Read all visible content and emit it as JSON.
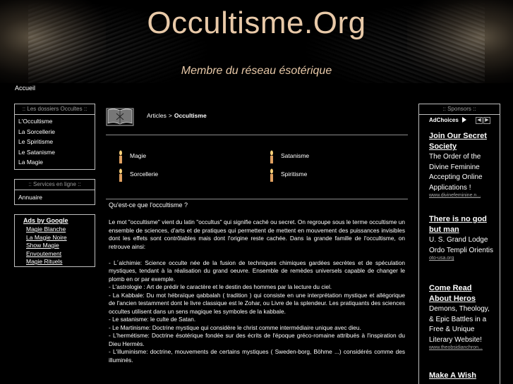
{
  "header": {
    "title": "Occultisme.Org",
    "subtitle": "Membre du réseau ésotérique",
    "home_link": "Accueil"
  },
  "left": {
    "dossiers": {
      "title": ":: Les dossiers Occultes ::",
      "items": [
        "L'Occultisme",
        "La Sorcellerie",
        "Le Spiritisme",
        "Le Satanisme",
        "La Magie"
      ]
    },
    "services": {
      "title": ":: Services en ligne ::",
      "items": [
        "Annuaire"
      ]
    },
    "ads": {
      "heading": "Ads by Google",
      "links": [
        "Magie Blanche",
        "La Magie Noire",
        "Show Magie",
        "Envoutement",
        "Magie Rituels"
      ]
    }
  },
  "center": {
    "breadcrumb": {
      "parent": "Articles",
      "separator": ">",
      "current": "Occultisme"
    },
    "categories": [
      "Magie",
      "Satanisme",
      "Sorcellerie",
      "Spiritisme"
    ],
    "intro_title": "Qu'est-ce que l'occultisme ?",
    "paragraphs": [
      "Le mot \"occultisme\" vient du latin \"occultus\" qui signifie caché ou secret. On regroupe sous le terme occultisme un ensemble de sciences, d'arts et de pratiques qui permettent de mettent en mouvement des puissances invisibles dont les effets sont contrôlables mais dont l'origine reste cachée. Dans la grande famille de l'occultisme, on retrouve ainsi:",
      "",
      "- L´alchimie: Science occulte née de la fusion de techniques chimiques gardées secrètes et de spéculation mystiques, tendant à la réalisation du grand oeuvre. Ensemble de remèdes universels capable de changer le plomb en or par exemple.",
      "- L'astrologie : Art de prédir le caractère et le destin des hommes par la lecture du ciel.",
      "- La Kabbale: Du mot hébraïque qabbalah ( tradition ) qui consiste en une interprétation mystique et allégorique de l'ancien testamment dont le livre classique est le Zohar, ou Livre de la splendeur. Les pratiquants des sciences occultes utilisent dans un sens magique les symboles de la kabbale.",
      "- Le satanisme: le culte de Satan.",
      "- Le Martinisme: Doctrine mystique qui considère le christ comme intermédiaire unique avec dieu.",
      "- L'hermétisme: Doctrine ésotérique fondée sur des écrits de l'époque gréco-romaine attribués à l'inspiration du Dieu Hermès.",
      "- L'illuminisme: doctrine, mouvements de certains mystiques ( Sweden-borg, Böhme ...) considérés comme des illuminés."
    ]
  },
  "right": {
    "title": ":: Sponsors ::",
    "adchoices": "AdChoices",
    "ads": [
      {
        "title": "Join Our Secret Society",
        "desc": "The Order of the Divine Feminine Accepting Online Applications !",
        "url": "www.divinefeminine.n..."
      },
      {
        "title": "There is no god but man",
        "desc": "U. S. Grand Lodge Ordo Templi Orientis",
        "url": "oto-usa.org"
      },
      {
        "title": "Come Read About Heros",
        "desc": "Demons, Theology, & Epic Battles in a Free & Unique Literary Website!",
        "url": "www.theobsidianchron..."
      },
      {
        "title": "Make A Wish",
        "desc": "",
        "url": ""
      }
    ]
  }
}
